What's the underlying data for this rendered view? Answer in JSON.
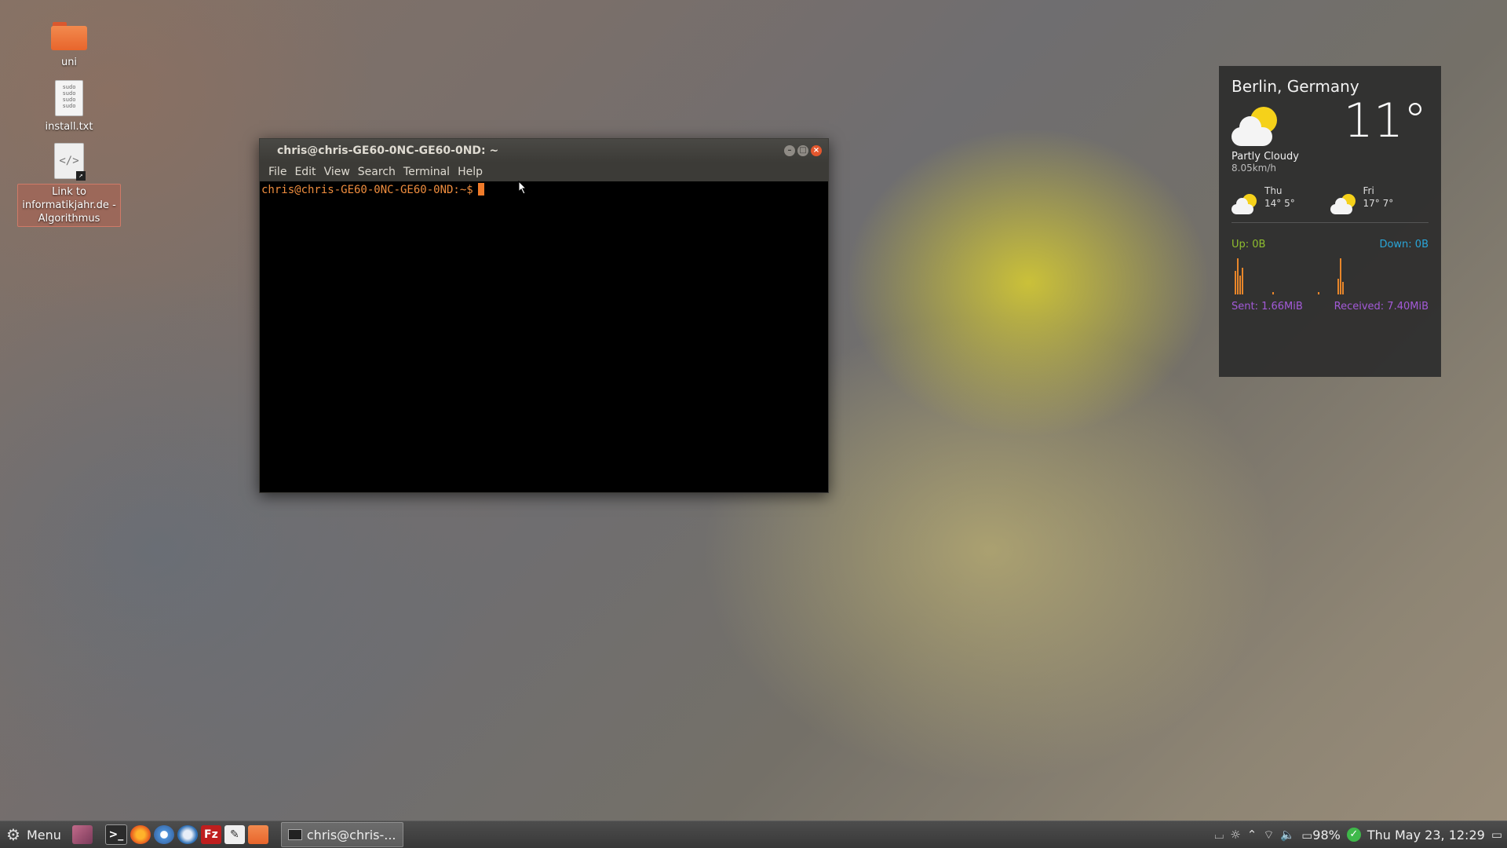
{
  "desktop": {
    "icons": [
      {
        "label": "uni",
        "type": "folder"
      },
      {
        "label": "install.txt",
        "type": "text-file",
        "preview": "sudo sudo sudo sudo"
      },
      {
        "label": "Link to informatikjahr.de - Algorithmus",
        "type": "html-link",
        "glyph": "</>"
      }
    ]
  },
  "terminal": {
    "title": "chris@chris-GE60-0NC-GE60-0ND: ~",
    "menu": [
      "File",
      "Edit",
      "View",
      "Search",
      "Terminal",
      "Help"
    ],
    "prompt": "chris@chris-GE60-0NC-GE60-0ND:~$",
    "buttons": {
      "minimize": "–",
      "maximize": "□",
      "close": "×"
    }
  },
  "weather": {
    "city": "Berlin, Germany",
    "temperature": "11°",
    "condition": "Partly Cloudy",
    "wind": "8.05km/h",
    "forecast": [
      {
        "day": "Thu",
        "temps": "14° 5°",
        "icon": "partly-cloudy-icon"
      },
      {
        "day": "Fri",
        "temps": "17° 7°",
        "icon": "partly-cloudy-icon"
      }
    ]
  },
  "network": {
    "up": "Up: 0B",
    "down": "Down: 0B",
    "sent": "Sent: 1.66MiB",
    "received": "Received: 7.40MiB",
    "colors": {
      "up": "#8fbf2f",
      "down": "#2aa6d9",
      "totals": "#a35ad8",
      "graph": "#e8862a"
    }
  },
  "taskbar": {
    "menu_label": "Menu",
    "launchers": [
      "desktop-icon",
      "terminal-icon",
      "firefox-icon",
      "chromium-icon",
      "thunderbird-icon",
      "filezilla-icon",
      "text-editor-icon",
      "files-icon"
    ],
    "filezilla_glyph": "Fz",
    "window_button": "chris@chris-...",
    "battery": "98%",
    "clock": "Thu May 23, 12:29"
  }
}
